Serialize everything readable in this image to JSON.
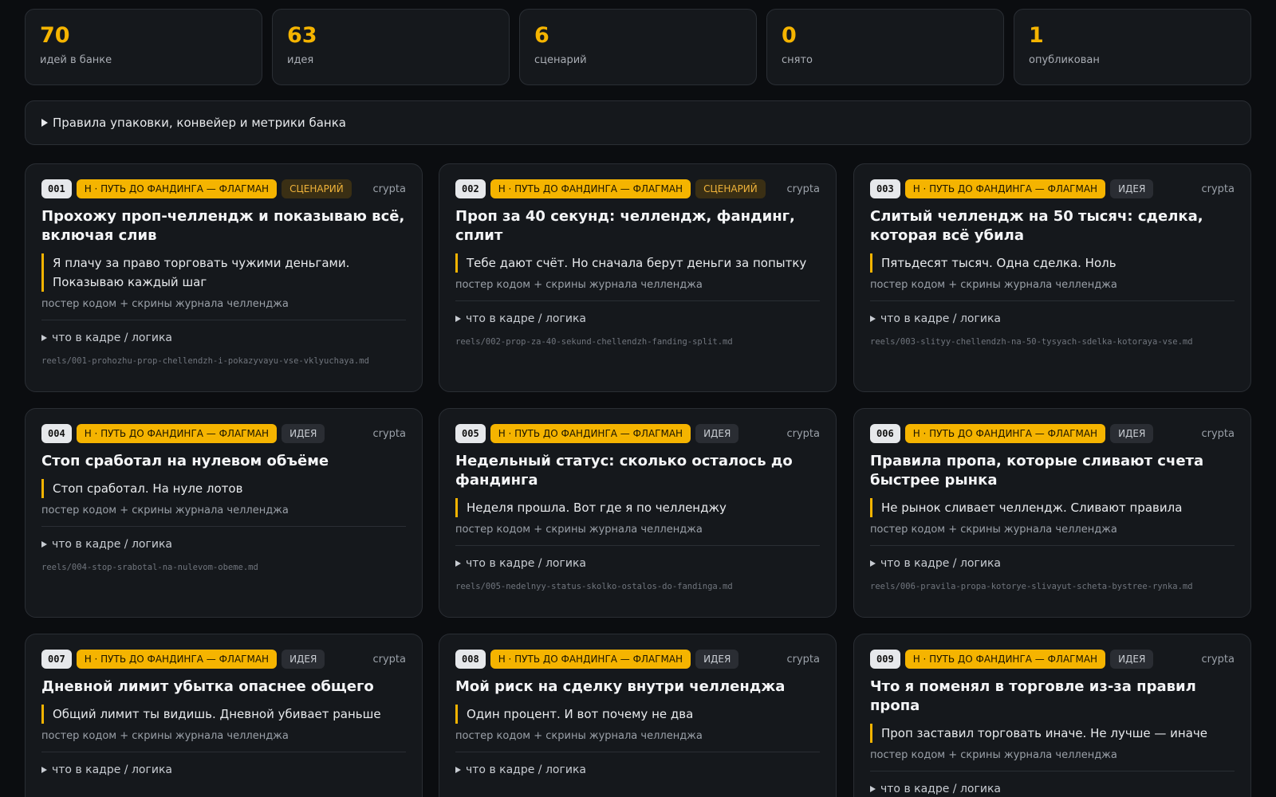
{
  "stats": [
    {
      "value": "70",
      "label": "идей в банке"
    },
    {
      "value": "63",
      "label": "идея"
    },
    {
      "value": "6",
      "label": "сценарий"
    },
    {
      "value": "0",
      "label": "снято"
    },
    {
      "value": "1",
      "label": "опубликован"
    }
  ],
  "rules_label": "Правила упаковки, конвейер и метрики банка",
  "category_label": "Н · ПУТЬ ДО ФАНДИНГА — ФЛАГМАН",
  "author": "crypta",
  "format_label": "постер кодом + скрины журнала челленджа",
  "logic_label": "что в кадре / логика",
  "colors": {
    "accent": "#f5b400",
    "background": "#0b0d10",
    "card": "#15181c"
  },
  "cards": [
    {
      "num": "001",
      "status": "СЦЕНАРИЙ",
      "title": "Прохожу проп-челлендж и показываю всё, включая слив",
      "hook": "Я плачу за право торговать чужими деньгами. Показываю каждый шаг",
      "path": "reels/001-prohozhu-prop-chellendzh-i-pokazyvayu-vse-vklyuchaya.md"
    },
    {
      "num": "002",
      "status": "СЦЕНАРИЙ",
      "title": "Проп за 40 секунд: челлендж, фандинг, сплит",
      "hook": "Тебе дают счёт. Но сначала берут деньги за попытку",
      "path": "reels/002-prop-za-40-sekund-chellendzh-fanding-split.md"
    },
    {
      "num": "003",
      "status": "ИДЕЯ",
      "title": "Слитый челлендж на 50 тысяч: сделка, которая всё убила",
      "hook": "Пятьдесят тысяч. Одна сделка. Ноль",
      "path": "reels/003-slityy-chellendzh-na-50-tysyach-sdelka-kotoraya-vse.md"
    },
    {
      "num": "004",
      "status": "ИДЕЯ",
      "title": "Стоп сработал на нулевом объёме",
      "hook": "Стоп сработал. На нуле лотов",
      "path": "reels/004-stop-srabotal-na-nulevom-obeme.md"
    },
    {
      "num": "005",
      "status": "ИДЕЯ",
      "title": "Недельный статус: сколько осталось до фандинга",
      "hook": "Неделя прошла. Вот где я по челленджу",
      "path": "reels/005-nedelnyy-status-skolko-ostalos-do-fandinga.md"
    },
    {
      "num": "006",
      "status": "ИДЕЯ",
      "title": "Правила пропа, которые сливают счета быстрее рынка",
      "hook": "Не рынок сливает челлендж. Сливают правила",
      "path": "reels/006-pravila-propa-kotorye-slivayut-scheta-bystree-rynka.md"
    },
    {
      "num": "007",
      "status": "ИДЕЯ",
      "title": "Дневной лимит убытка опаснее общего",
      "hook": "Общий лимит ты видишь. Дневной убивает раньше",
      "path": ""
    },
    {
      "num": "008",
      "status": "ИДЕЯ",
      "title": "Мой риск на сделку внутри челленджа",
      "hook": "Один процент. И вот почему не два",
      "path": ""
    },
    {
      "num": "009",
      "status": "ИДЕЯ",
      "title": "Что я поменял в торговле из-за правил пропа",
      "hook": "Проп заставил торговать иначе. Не лучше — иначе",
      "path": ""
    }
  ]
}
